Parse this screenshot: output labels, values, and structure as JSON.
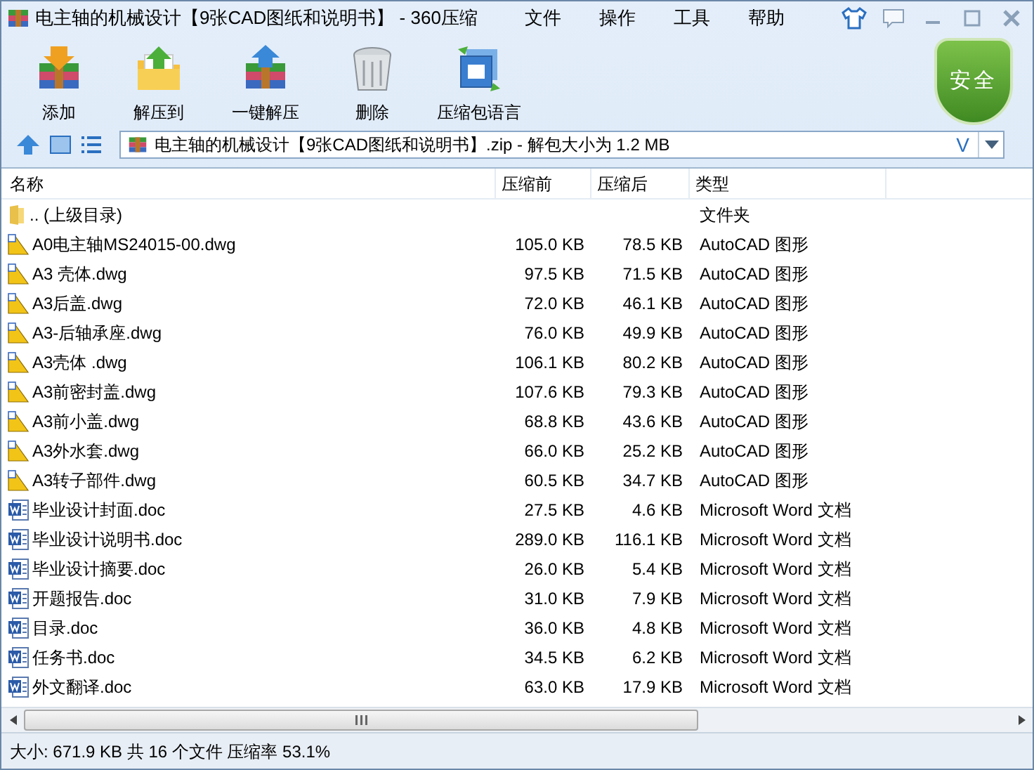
{
  "window": {
    "title": "电主轴的机械设计【9张CAD图纸和说明书】 - 360压缩"
  },
  "menu": [
    "文件",
    "操作",
    "工具",
    "帮助"
  ],
  "toolbar": [
    "添加",
    "解压到",
    "一键解压",
    "删除",
    "压缩包语言"
  ],
  "security_badge": "安全",
  "address": {
    "path": "电主轴的机械设计【9张CAD图纸和说明书】.zip - 解包大小为 1.2 MB",
    "v_mark": "V"
  },
  "table": {
    "columns": [
      "名称",
      "压缩前",
      "压缩后",
      "类型"
    ],
    "rows": [
      {
        "kind": "folder",
        "name": ".. (上级目录)",
        "type": "文件夹"
      },
      {
        "kind": "dwg",
        "name": "A0电主轴MS24015-00.dwg",
        "before": "105.0 KB",
        "after": "78.5 KB",
        "type": "AutoCAD 图形"
      },
      {
        "kind": "dwg",
        "name": "A3 壳体.dwg",
        "before": "97.5 KB",
        "after": "71.5 KB",
        "type": "AutoCAD 图形"
      },
      {
        "kind": "dwg",
        "name": "A3后盖.dwg",
        "before": "72.0 KB",
        "after": "46.1 KB",
        "type": "AutoCAD 图形"
      },
      {
        "kind": "dwg",
        "name": "A3-后轴承座.dwg",
        "before": "76.0 KB",
        "after": "49.9 KB",
        "type": "AutoCAD 图形"
      },
      {
        "kind": "dwg",
        "name": "A3壳体 .dwg",
        "before": "106.1 KB",
        "after": "80.2 KB",
        "type": "AutoCAD 图形"
      },
      {
        "kind": "dwg",
        "name": "A3前密封盖.dwg",
        "before": "107.6 KB",
        "after": "79.3 KB",
        "type": "AutoCAD 图形"
      },
      {
        "kind": "dwg",
        "name": "A3前小盖.dwg",
        "before": "68.8 KB",
        "after": "43.6 KB",
        "type": "AutoCAD 图形"
      },
      {
        "kind": "dwg",
        "name": "A3外水套.dwg",
        "before": "66.0 KB",
        "after": "25.2 KB",
        "type": "AutoCAD 图形"
      },
      {
        "kind": "dwg",
        "name": "A3转子部件.dwg",
        "before": "60.5 KB",
        "after": "34.7 KB",
        "type": "AutoCAD 图形"
      },
      {
        "kind": "doc",
        "name": "毕业设计封面.doc",
        "before": "27.5 KB",
        "after": "4.6 KB",
        "type": "Microsoft Word 文档"
      },
      {
        "kind": "doc",
        "name": "毕业设计说明书.doc",
        "before": "289.0 KB",
        "after": "116.1 KB",
        "type": "Microsoft Word 文档"
      },
      {
        "kind": "doc",
        "name": "毕业设计摘要.doc",
        "before": "26.0 KB",
        "after": "5.4 KB",
        "type": "Microsoft Word 文档"
      },
      {
        "kind": "doc",
        "name": "开题报告.doc",
        "before": "31.0 KB",
        "after": "7.9 KB",
        "type": "Microsoft Word 文档"
      },
      {
        "kind": "doc",
        "name": "目录.doc",
        "before": "36.0 KB",
        "after": "4.8 KB",
        "type": "Microsoft Word 文档"
      },
      {
        "kind": "doc",
        "name": "任务书.doc",
        "before": "34.5 KB",
        "after": "6.2 KB",
        "type": "Microsoft Word 文档"
      },
      {
        "kind": "doc",
        "name": "外文翻译.doc",
        "before": "63.0 KB",
        "after": "17.9 KB",
        "type": "Microsoft Word 文档"
      }
    ]
  },
  "status_bar": "大小: 671.9 KB 共 16 个文件 压缩率 53.1%"
}
